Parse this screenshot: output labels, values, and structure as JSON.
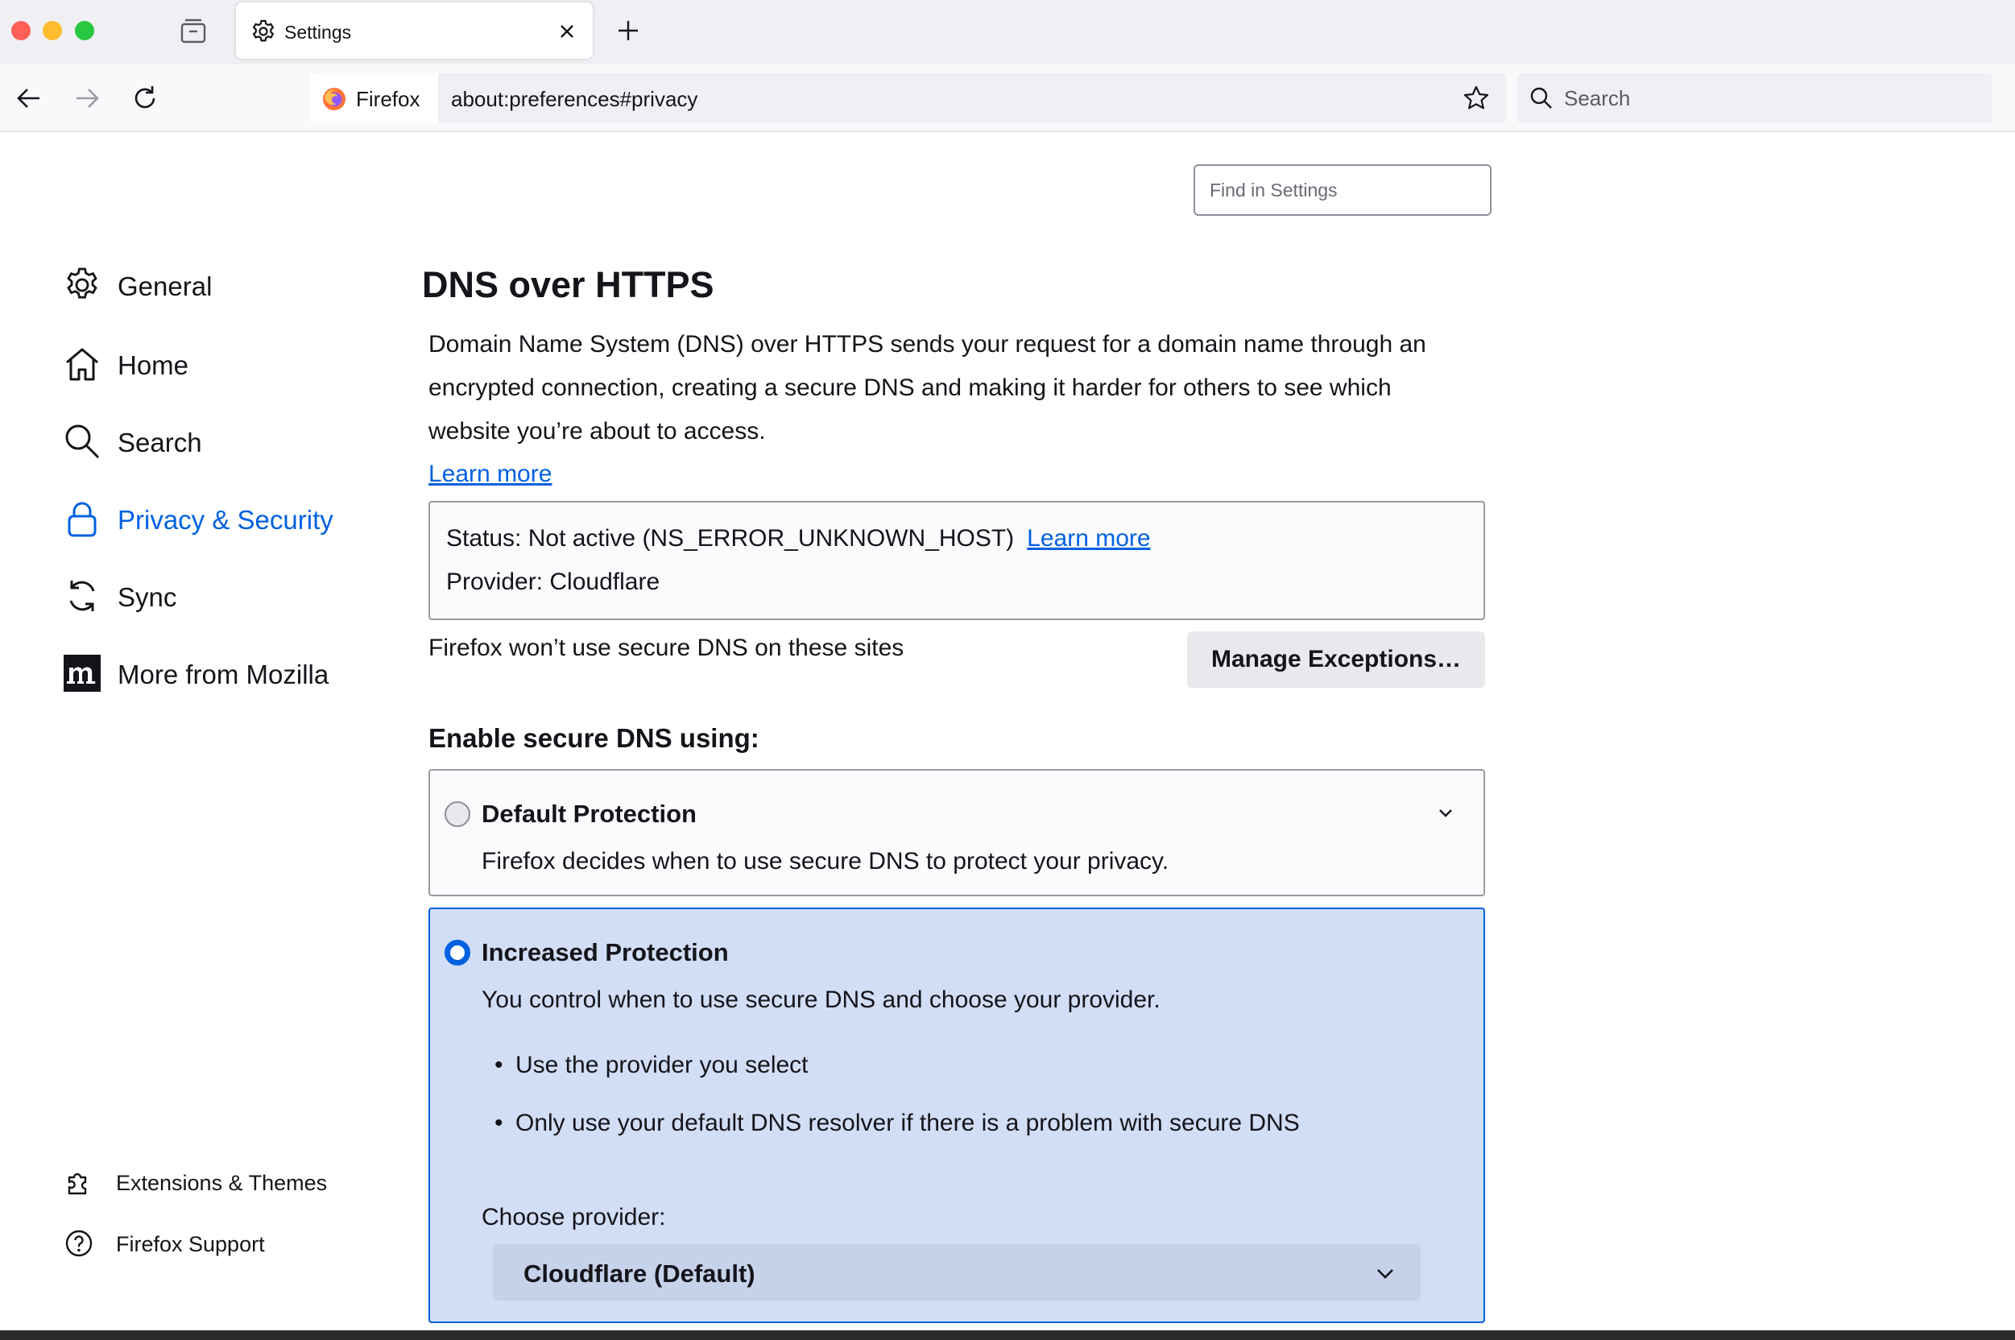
{
  "tab": {
    "title": "Settings"
  },
  "nav": {
    "identity_label": "Firefox",
    "url": "about:preferences#privacy",
    "search_placeholder": "Search"
  },
  "find": {
    "placeholder": "Find in Settings"
  },
  "sidebar": {
    "items": [
      {
        "label": "General",
        "icon": "gear-icon"
      },
      {
        "label": "Home",
        "icon": "home-icon"
      },
      {
        "label": "Search",
        "icon": "search-icon"
      },
      {
        "label": "Privacy & Security",
        "icon": "lock-icon",
        "selected": true
      },
      {
        "label": "Sync",
        "icon": "sync-icon"
      },
      {
        "label": "More from Mozilla",
        "icon": "mozilla-icon"
      }
    ],
    "footer": [
      {
        "label": "Extensions & Themes",
        "icon": "puzzle-icon"
      },
      {
        "label": "Firefox Support",
        "icon": "help-icon"
      }
    ]
  },
  "main": {
    "title": "DNS over HTTPS",
    "description": [
      "Domain Name System (DNS) over HTTPS sends your request for a domain name through an",
      "encrypted connection, creating a secure DNS and making it harder for others to see which",
      "website you’re about to access."
    ],
    "learn_more": "Learn more",
    "status": {
      "text": "Status: Not active (NS_ERROR_UNKNOWN_HOST)",
      "learn_more": "Learn more",
      "provider": "Provider: Cloudflare"
    },
    "exceptions_text": "Firefox won’t use secure DNS on these sites",
    "manage_button": "Manage Exceptions…",
    "enable_heading": "Enable secure DNS using:",
    "options": {
      "default": {
        "title": "Default Protection",
        "description": "Firefox decides when to use secure DNS to protect your privacy.",
        "selected": false
      },
      "increased": {
        "title": "Increased Protection",
        "description": "You control when to use secure DNS and choose your provider.",
        "bullets": [
          "Use the provider you select",
          "Only use your default DNS resolver if there is a problem with secure DNS"
        ],
        "choose_label": "Choose provider:",
        "provider_value": "Cloudflare (Default)",
        "selected": true
      }
    }
  },
  "colors": {
    "accent": "#0061e0",
    "selected_card_bg": "#d1def5",
    "chrome_bg": "#f0f0f4"
  }
}
